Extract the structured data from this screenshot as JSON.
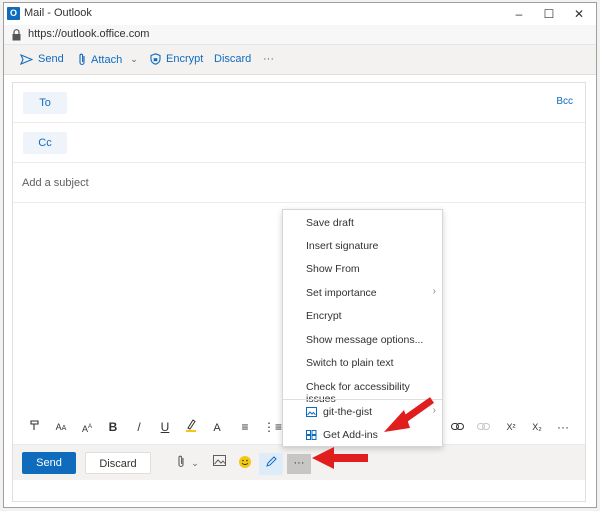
{
  "window": {
    "title": "Mail - Outlook",
    "url": "https://outlook.office.com"
  },
  "commandbar": {
    "send": "Send",
    "attach": "Attach",
    "encrypt": "Encrypt",
    "discard": "Discard",
    "more": "···"
  },
  "compose": {
    "to_label": "To",
    "cc_label": "Cc",
    "bcc_label": "Bcc",
    "subject_placeholder": "Add a subject"
  },
  "format_toolbar": {
    "bold": "B",
    "italic": "/",
    "underline": "U",
    "superscript": "X²",
    "subscript": "X₂",
    "more": "···"
  },
  "bottom_bar": {
    "send": "Send",
    "discard": "Discard",
    "more": "···"
  },
  "menu": {
    "items": [
      "Save draft",
      "Insert signature",
      "Show From",
      "Set importance",
      "Encrypt",
      "Show message options...",
      "Switch to plain text",
      "Check for accessibility issues"
    ],
    "addins": [
      "git-the-gist",
      "Get Add-ins"
    ]
  },
  "colors": {
    "accent": "#0f6cbd",
    "arrow": "#e01e1e"
  }
}
